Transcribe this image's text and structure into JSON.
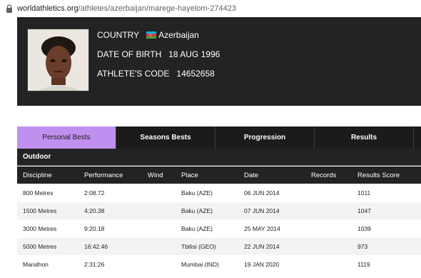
{
  "browser": {
    "url_host": "worldathletics.org",
    "url_path": "/athletes/azerbaijan/marege-hayelom-274423"
  },
  "profile": {
    "country_label": "COUNTRY",
    "country_value": "Azerbaijan",
    "dob_label": "DATE OF BIRTH",
    "dob_value": "18 AUG 1996",
    "code_label": "ATHLETE'S CODE",
    "code_value": "14652658"
  },
  "tabs": [
    {
      "label": "Personal Bests",
      "active": true
    },
    {
      "label": "Seasons Bests",
      "active": false
    },
    {
      "label": "Progression",
      "active": false
    },
    {
      "label": "Results",
      "active": false
    }
  ],
  "section_title": "Outdoor",
  "columns": [
    "Discipline",
    "Performance",
    "Wind",
    "Place",
    "Date",
    "Records",
    "Results Score"
  ],
  "rows": [
    {
      "discipline": "800 Metres",
      "performance": "2:08.72",
      "wind": "",
      "place": "Baku (AZE)",
      "date": "06 JUN 2014",
      "records": "",
      "score": "1011"
    },
    {
      "discipline": "1500 Metres",
      "performance": "4:20.38",
      "wind": "",
      "place": "Baku (AZE)",
      "date": "07 JUN 2014",
      "records": "",
      "score": "1047"
    },
    {
      "discipline": "3000 Metres",
      "performance": "9:20.18",
      "wind": "",
      "place": "Baku (AZE)",
      "date": "25 MAY 2014",
      "records": "",
      "score": "1039"
    },
    {
      "discipline": "5000 Metres",
      "performance": "16:42.46",
      "wind": "",
      "place": "Tbilisi (GEO)",
      "date": "22 JUN 2014",
      "records": "",
      "score": "973"
    },
    {
      "discipline": "Marathon",
      "performance": "2:31:26",
      "wind": "",
      "place": "Mumbai (IND)",
      "date": "19 JAN 2020",
      "records": "",
      "score": "1119"
    }
  ],
  "icons": {
    "lock": "lock-icon",
    "flag": "azerbaijan-flag-icon"
  },
  "colors": {
    "accent": "#c090f0",
    "panel": "#232323",
    "tab_bar": "#1b1b1b",
    "row_alt": "#f3f3f3"
  }
}
